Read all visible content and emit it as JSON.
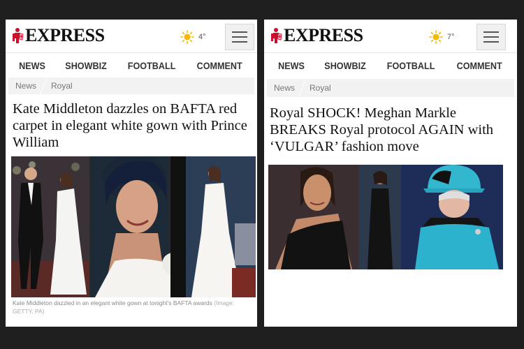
{
  "left": {
    "brand": "EXPRESS",
    "weather": {
      "icon": "sun-icon",
      "temp": "4°"
    },
    "nav": [
      "NEWS",
      "SHOWBIZ",
      "FOOTBALL",
      "COMMENT"
    ],
    "breadcrumb": [
      "News",
      "Royal"
    ],
    "headline": "Kate Middleton dazzles on BAFTA red carpet in elegant white gown with Prince William",
    "caption": "Kate Middleton dazzled in an elegant white gown at tonight's BAFTA awards",
    "caption_credit": "(Image: GETTY, PA)"
  },
  "right": {
    "brand": "EXPRESS",
    "weather": {
      "icon": "sun-icon",
      "temp": "7°"
    },
    "nav": [
      "NEWS",
      "SHOWBIZ",
      "FOOTBALL",
      "COMMENT"
    ],
    "breadcrumb": [
      "News",
      "Royal"
    ],
    "headline": "Royal SHOCK! Meghan Markle BREAKS Royal protocol AGAIN with ‘VULGAR’ fashion move"
  },
  "colors": {
    "brand_red": "#c8102e",
    "sun": "#f5b800",
    "background": "#1f1f1f",
    "crumb_bg": "#f2f2f2"
  }
}
